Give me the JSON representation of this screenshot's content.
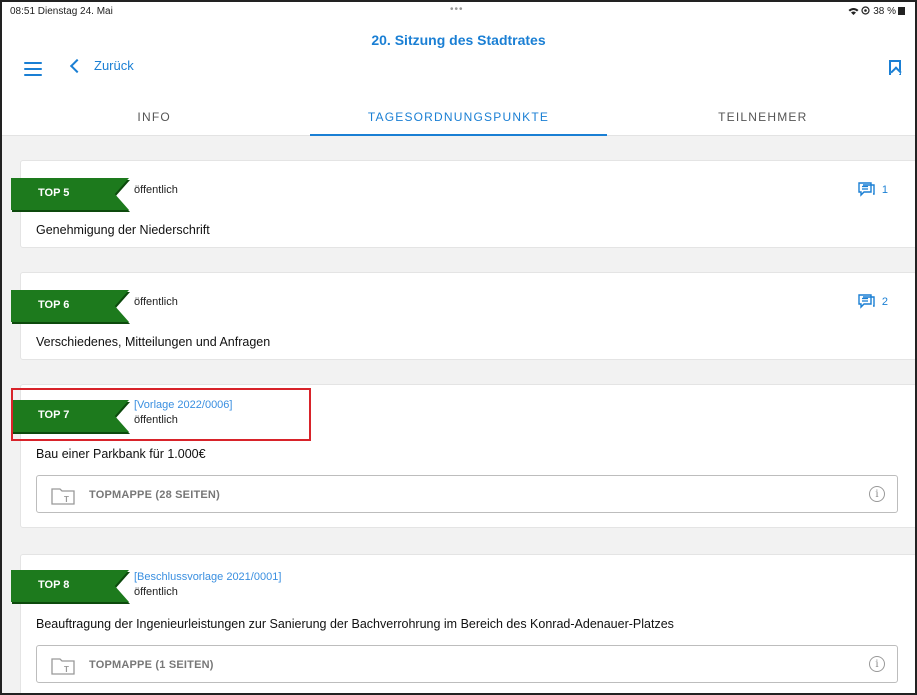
{
  "status_bar": {
    "time_date": "08:51  Dienstag 24. Mai",
    "dots": "•••",
    "right": "38 %"
  },
  "header": {
    "title": "20. Sitzung des Stadtrates",
    "back_label": "Zurück"
  },
  "tabs": [
    {
      "label": "INFO",
      "active": false
    },
    {
      "label": "TAGESORDNUNGSPUNKTE",
      "active": true
    },
    {
      "label": "TEILNEHMER",
      "active": false
    }
  ],
  "items": [
    {
      "top": "TOP 5",
      "visibility": "öffentlich",
      "subject": "Genehmigung der Niederschrift",
      "comment_count": "1"
    },
    {
      "top": "TOP 6",
      "visibility": "öffentlich",
      "subject": "Verschiedenes, Mitteilungen und Anfragen",
      "comment_count": "2"
    },
    {
      "top": "TOP 7",
      "vorlage": "[Vorlage 2022/0006]",
      "visibility": "öffentlich",
      "subject": "Bau einer Parkbank für 1.000€",
      "mappe": "TOPMAPPE (28 SEITEN)"
    },
    {
      "top": "TOP 8",
      "vorlage": "[Beschlussvorlage 2021/0001]",
      "visibility": "öffentlich",
      "subject": "Beauftragung der Ingenieurleistungen zur Sanierung der Bachverrohrung im Bereich des Konrad-Adenauer-Platzes",
      "mappe": "TOPMAPPE (1 SEITEN)"
    }
  ],
  "colors": {
    "accent": "#1a7fd4",
    "ribbon": "#1d7a1d",
    "highlight": "#d8232a"
  }
}
